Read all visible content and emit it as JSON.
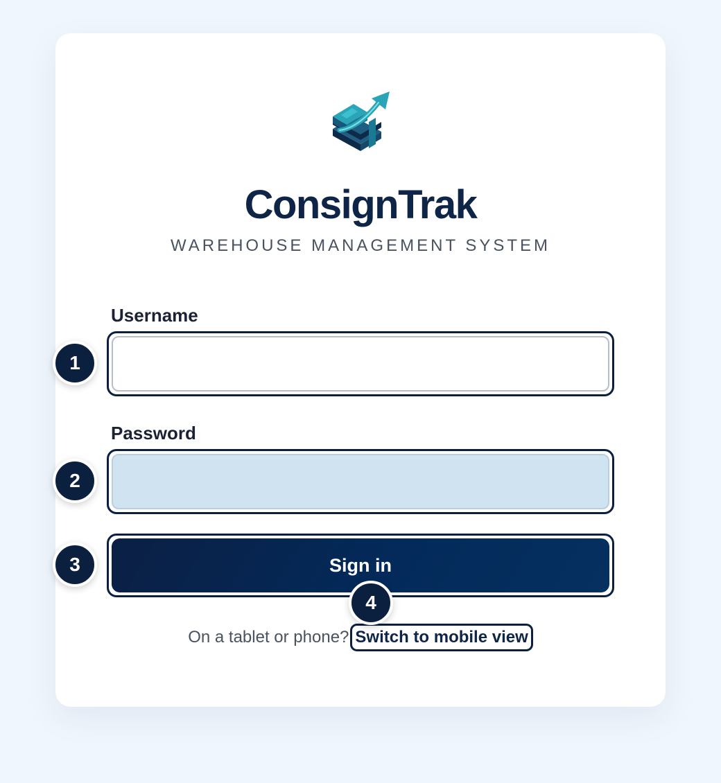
{
  "app": {
    "brand_name": "ConsignTrak",
    "tagline": "WAREHOUSE MANAGEMENT SYSTEM",
    "logo_icon": "warehouse-box-arrow-icon"
  },
  "form": {
    "username_label": "Username",
    "username_value": "",
    "password_label": "Password",
    "password_value": "",
    "signin_label": "Sign in"
  },
  "mobile": {
    "prompt": "On a tablet or phone?",
    "link_label": "Switch to mobile view"
  },
  "annotations": {
    "badge1": "1",
    "badge2": "2",
    "badge3": "3",
    "badge4": "4"
  },
  "colors": {
    "page_background": "#f0f6fd",
    "brand_navy": "#0f2547",
    "accent_teal": "#2aa5b8",
    "password_field_fill": "#cfe3f1"
  }
}
